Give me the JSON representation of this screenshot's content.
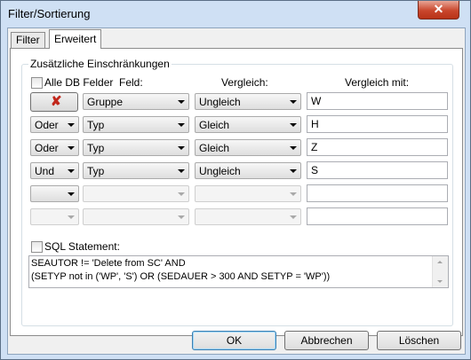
{
  "window": {
    "title": "Filter/Sortierung",
    "close_label": "✕"
  },
  "tabs": [
    {
      "label": "Filter"
    },
    {
      "label": "Erweitert"
    }
  ],
  "group": {
    "legend": "Zusätzliche Einschränkungen",
    "alle_db_felder_label": "Alle DB Felder",
    "col_feld": "Feld:",
    "col_vergleich": "Vergleich:",
    "col_vergleich_mit": "Vergleich mit:"
  },
  "rows": [
    {
      "connector": "",
      "field": "Gruppe",
      "compare": "Ungleich",
      "value": "W"
    },
    {
      "connector": "Oder",
      "field": "Typ",
      "compare": "Gleich",
      "value": "H"
    },
    {
      "connector": "Oder",
      "field": "Typ",
      "compare": "Gleich",
      "value": "Z"
    },
    {
      "connector": "Und",
      "field": "Typ",
      "compare": "Ungleich",
      "value": "S"
    },
    {
      "connector": "",
      "field": "",
      "compare": "",
      "value": ""
    },
    {
      "connector": "",
      "field": "",
      "compare": "",
      "value": ""
    }
  ],
  "sql": {
    "label": "SQL Statement:",
    "lines": [
      "SEAUTOR != 'Delete from SC' AND",
      "(SETYP not in ('WP', 'S') OR (SEDAUER > 300 AND SETYP = 'WP'))"
    ]
  },
  "buttons": {
    "ok": "OK",
    "abbrechen": "Abbrechen",
    "loeschen": "Löschen"
  },
  "icons": {
    "delete_row": "red-x-icon"
  },
  "colors": {
    "title_bar": "#cfe0f4",
    "close_button": "#c9462c",
    "delete_x": "#c1261b"
  }
}
